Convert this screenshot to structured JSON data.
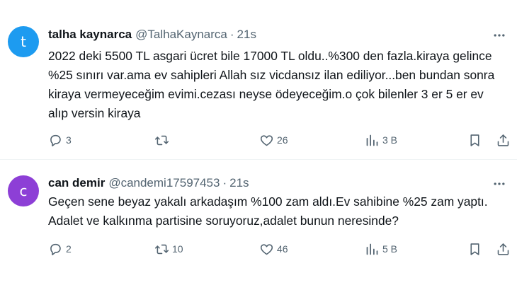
{
  "tweets": [
    {
      "avatar_letter": "t",
      "avatar_color": "#1d9bf0",
      "name": "talha kaynarca",
      "handle": "@TalhaKaynarca",
      "separator": "·",
      "time": "21s",
      "text": "2022 deki 5500 TL asgari ücret bile 17000 TL oldu..%300 den fazla.kiraya gelince %25 sınırı var.ama ev sahipleri Allah sız vicdansız ilan ediliyor...ben bundan sonra kiraya vermeyeceğim evimi.cezası neyse ödeyeceğim.o çok bilenler 3 er 5 er ev alıp versin kiraya",
      "replies": "3",
      "retweets": "",
      "likes": "26",
      "views": "3 B"
    },
    {
      "avatar_letter": "c",
      "avatar_color": "#8d3fd6",
      "name": "can demir",
      "handle": "@candemi17597453",
      "separator": "·",
      "time": "21s",
      "text": "Geçen sene beyaz yakalı arkadaşım %100 zam aldı.Ev sahibine %25 zam yaptı. Adalet ve kalkınma partisine soruyoruz,adalet bunun neresinde?",
      "replies": "2",
      "retweets": "10",
      "likes": "46",
      "views": "5 B"
    }
  ],
  "icons": {
    "reply": "reply-icon",
    "retweet": "retweet-icon",
    "like": "heart-icon",
    "views": "views-icon",
    "bookmark": "bookmark-icon",
    "share": "share-icon",
    "more": "more-icon"
  },
  "colors": {
    "secondary_text": "#536471",
    "divider": "#eff3f4"
  }
}
